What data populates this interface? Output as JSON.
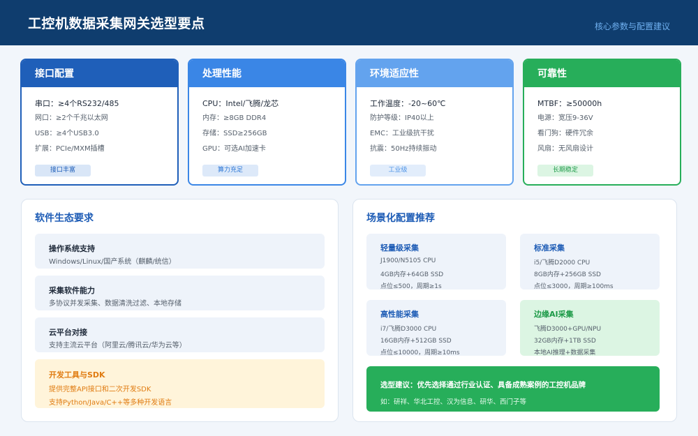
{
  "header": {
    "title": "工控机数据采集网关选型要点",
    "subtitle": "核心参数与配置建议"
  },
  "colors": {
    "blue_dark": "#1f5fb9",
    "blue_mid": "#3a86e6",
    "blue_light": "#63a3ee",
    "green": "#27ae5a"
  },
  "cards": [
    {
      "title": "接口配置",
      "main": "串口：≥4个RS232/485",
      "lines": [
        "网口：≥2个千兆以太网",
        "USB：≥4个USB3.0",
        "扩展：PCIe/MXM插槽"
      ],
      "tag": "接口丰富"
    },
    {
      "title": "处理性能",
      "main": "CPU：Intel/飞腾/龙芯",
      "lines": [
        "内存：≥8GB DDR4",
        "存储：SSD≥256GB",
        "GPU：可选AI加速卡"
      ],
      "tag": "算力充足"
    },
    {
      "title": "环境适应性",
      "main": "工作温度：-20~60℃",
      "lines": [
        "防护等级：IP40以上",
        "EMC：工业级抗干扰",
        "抗震：50Hz持续振动"
      ],
      "tag": "工业级"
    },
    {
      "title": "可靠性",
      "main": "MTBF：≥50000h",
      "lines": [
        "电源：宽压9-36V",
        "看门狗：硬件冗余",
        "风扇：无风扇设计"
      ],
      "tag": "长期稳定"
    }
  ],
  "software": {
    "title": "软件生态要求",
    "items": [
      {
        "title": "操作系统支持",
        "desc": "Windows/Linux/国产系统（麒麟/统信）"
      },
      {
        "title": "采集软件能力",
        "desc": "多协议并发采集、数据清洗过滤、本地存储"
      },
      {
        "title": "云平台对接",
        "desc": "支持主流云平台（阿里云/腾讯云/华为云等）"
      }
    ],
    "sdk": {
      "title": "开发工具与SDK",
      "line1": "提供完整API接口和二次开发SDK",
      "line2": "支持Python/Java/C++等多种开发语言"
    }
  },
  "scenarios": {
    "title": "场景化配置推荐",
    "items": [
      {
        "title": "轻量级采集",
        "lines": [
          "J1900/N5105 CPU",
          "4GB内存+64GB SSD",
          "点位≤500，周期≥1s"
        ]
      },
      {
        "title": "标准采集",
        "lines": [
          "i5/飞腾D2000 CPU",
          "8GB内存+256GB SSD",
          "点位≤3000，周期≥100ms"
        ]
      },
      {
        "title": "高性能采集",
        "lines": [
          "i7/飞腾D3000 CPU",
          "16GB内存+512GB SSD",
          "点位≤10000，周期≥10ms"
        ]
      },
      {
        "title": "边缘AI采集",
        "lines": [
          "飞腾D3000+GPU/NPU",
          "32GB内存+1TB SSD",
          "本地AI推理+数据采集"
        ]
      }
    ],
    "advice": {
      "title": "选型建议：优先选择通过行业认证、具备成熟案例的工控机品牌",
      "desc": "如：研祥、华北工控、汉为信息、研华、西门子等"
    }
  }
}
